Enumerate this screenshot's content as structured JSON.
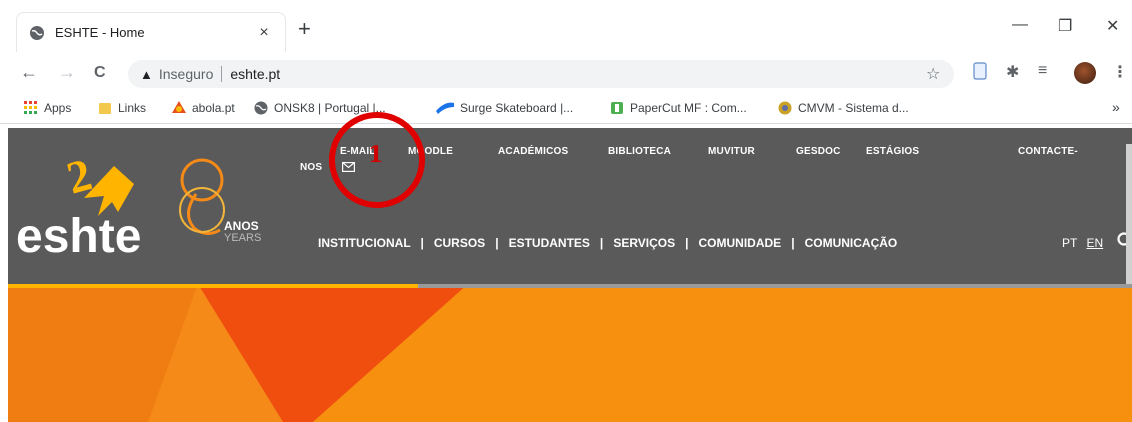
{
  "browser": {
    "tab_title": "ESHTE - Home",
    "tab_close": "×",
    "new_tab": "+",
    "window": {
      "minimize": "—",
      "restore": "❐",
      "close": "✕"
    },
    "nav": {
      "back": "←",
      "forward": "→",
      "reload": "C"
    },
    "security_label": "Inseguro",
    "url": "eshte.pt"
  },
  "bookmarks": [
    {
      "label": "Apps",
      "icon": "apps-grid-icon",
      "color": "#e94235"
    },
    {
      "label": "Links",
      "icon": "folder-icon",
      "color": "#f2c94c"
    },
    {
      "label": "abola.pt",
      "icon": "abola-icon",
      "color": "#e8501b"
    },
    {
      "label": "ONSK8 | Portugal |...",
      "icon": "globe-icon",
      "color": "#5f6368"
    },
    {
      "label": "Surge Skateboard |...",
      "icon": "surge-icon",
      "color": "#1a73e8"
    },
    {
      "label": "PaperCut MF : Com...",
      "icon": "papercut-icon",
      "color": "#4caf50"
    },
    {
      "label": "CMVM - Sistema d...",
      "icon": "cmvm-icon",
      "color": "#c9a227"
    }
  ],
  "bookmarks_more": "»",
  "site": {
    "logo_text": "eshte",
    "anniversary_anos": "ANOS",
    "anniversary_years": "YEARS",
    "top_nav": {
      "nos": "NOS",
      "email": "E-MAIL",
      "moodle": "MOODLE",
      "academicos": "ACADÉMICOS",
      "biblioteca": "BIBLIOTECA",
      "muvitur": "MUVITUR",
      "gesdoc": "GESDOC",
      "estagios": "ESTÁGIOS",
      "contacte": "CONTACTE-"
    },
    "main_nav": [
      "INSTITUCIONAL",
      "CURSOS",
      "ESTUDANTES",
      "SERVIÇOS",
      "COMUNIDADE",
      "COMUNICAÇÃO"
    ],
    "lang_pt": "PT",
    "lang_en": "EN"
  },
  "annotation": {
    "number": "1",
    "color": "#e00000"
  },
  "colors": {
    "header": "#5a5a5a",
    "hero": "#f58a18",
    "accent": "#ffb400",
    "hero_triangle": "#f04e0f"
  }
}
